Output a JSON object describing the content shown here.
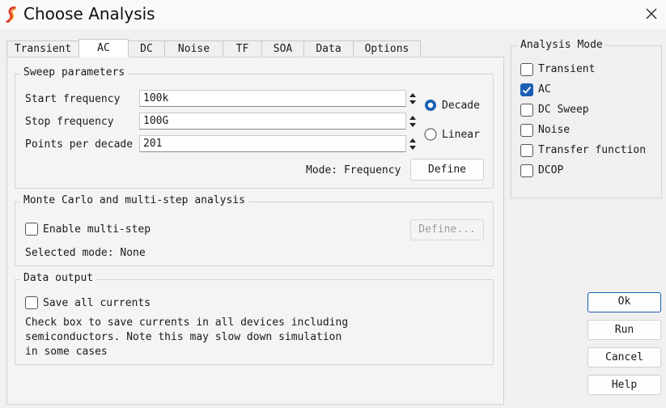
{
  "window": {
    "title": "Choose Analysis",
    "app_icon": "simetrix-logo-icon",
    "close_icon": "close-icon"
  },
  "tabs": [
    {
      "label": "Transient",
      "active": false
    },
    {
      "label": "AC",
      "active": true
    },
    {
      "label": "DC",
      "active": false
    },
    {
      "label": "Noise",
      "active": false
    },
    {
      "label": "TF",
      "active": false
    },
    {
      "label": "SOA",
      "active": false
    },
    {
      "label": "Data",
      "active": false
    },
    {
      "label": "Options",
      "active": false
    }
  ],
  "sweep": {
    "title": "Sweep parameters",
    "start_label": "Start frequency",
    "start_value": "100k",
    "stop_label": "Stop frequency",
    "stop_value": "100G",
    "points_label": "Points per decade",
    "points_value": "201",
    "decade_label": "Decade",
    "decade_selected": true,
    "linear_label": "Linear",
    "linear_selected": false,
    "mode_text": "Mode: Frequency",
    "define_label": "Define"
  },
  "monte_carlo": {
    "title": "Monte Carlo and multi-step analysis",
    "enable_label": "Enable multi-step",
    "enable_checked": false,
    "define_label": "Define...",
    "selected_mode_text": "Selected mode: None"
  },
  "data_output": {
    "title": "Data output",
    "save_label": "Save all currents",
    "save_checked": false,
    "help_line1": "Check box to save currents in all devices including",
    "help_line2": "semiconductors. Note this may slow down simulation",
    "help_line3": "in some cases"
  },
  "analysis_mode": {
    "title": "Analysis Mode",
    "items": [
      {
        "label": "Transient",
        "checked": false
      },
      {
        "label": "AC",
        "checked": true
      },
      {
        "label": "DC Sweep",
        "checked": false
      },
      {
        "label": "Noise",
        "checked": false
      },
      {
        "label": "Transfer function",
        "checked": false
      },
      {
        "label": "DCOP",
        "checked": false
      }
    ]
  },
  "buttons": {
    "ok": "Ok",
    "run": "Run",
    "cancel": "Cancel",
    "help": "Help"
  },
  "colors": {
    "accent": "#1a5fb4",
    "logo_red": "#e03a2a",
    "logo_orange": "#f39a1e",
    "background": "#f0f0f0"
  }
}
